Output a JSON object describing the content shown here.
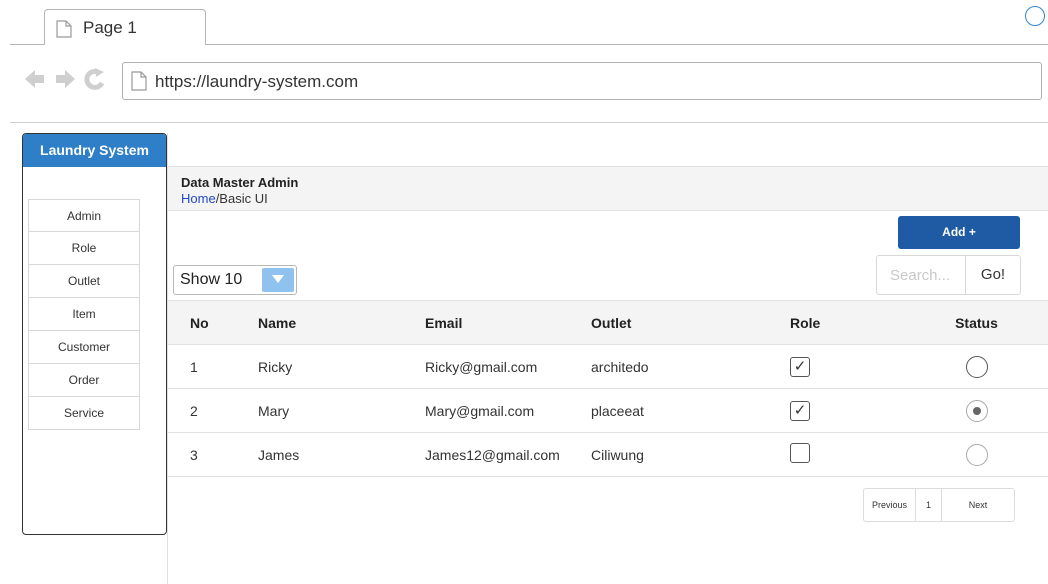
{
  "browser": {
    "tab_title": "Page 1",
    "url": "https://laundry-system.com"
  },
  "sidebar": {
    "title": "Laundry System",
    "items": [
      {
        "label": "Admin"
      },
      {
        "label": "Role"
      },
      {
        "label": "Outlet"
      },
      {
        "label": "Item"
      },
      {
        "label": "Customer"
      },
      {
        "label": "Order"
      },
      {
        "label": "Service"
      }
    ]
  },
  "header": {
    "title": "Data Master Admin",
    "breadcrumb_home": "Home",
    "breadcrumb_rest": "/Basic UI"
  },
  "toolbar": {
    "add_label": "Add +",
    "show_label": "Show 10",
    "search_placeholder": "Search...",
    "go_label": "Go!"
  },
  "table": {
    "columns": [
      "No",
      "Name",
      "Email",
      "Outlet",
      "Role",
      "Status"
    ],
    "rows": [
      {
        "no": "1",
        "name": "Ricky",
        "email": "Ricky@gmail.com",
        "outlet": "architedo",
        "role_check": "✓",
        "role_checked": true,
        "status": "unselected"
      },
      {
        "no": "2",
        "name": "Mary",
        "email": "Mary@gmail.com",
        "outlet": "placeeat",
        "role_check": "✓",
        "role_checked": true,
        "status": "selected"
      },
      {
        "no": "3",
        "name": "James",
        "email": "James12@gmail.com",
        "outlet": "Ciliwung",
        "role_check": "",
        "role_checked": false,
        "status": "unselected"
      }
    ]
  },
  "pagination": {
    "prev_label": "Previous",
    "page": "1",
    "next_label": "Next"
  },
  "colors": {
    "sidebar_header": "#2f7fc8",
    "add_button": "#1f5aa5",
    "breadcrumb_link": "#2348c8"
  }
}
